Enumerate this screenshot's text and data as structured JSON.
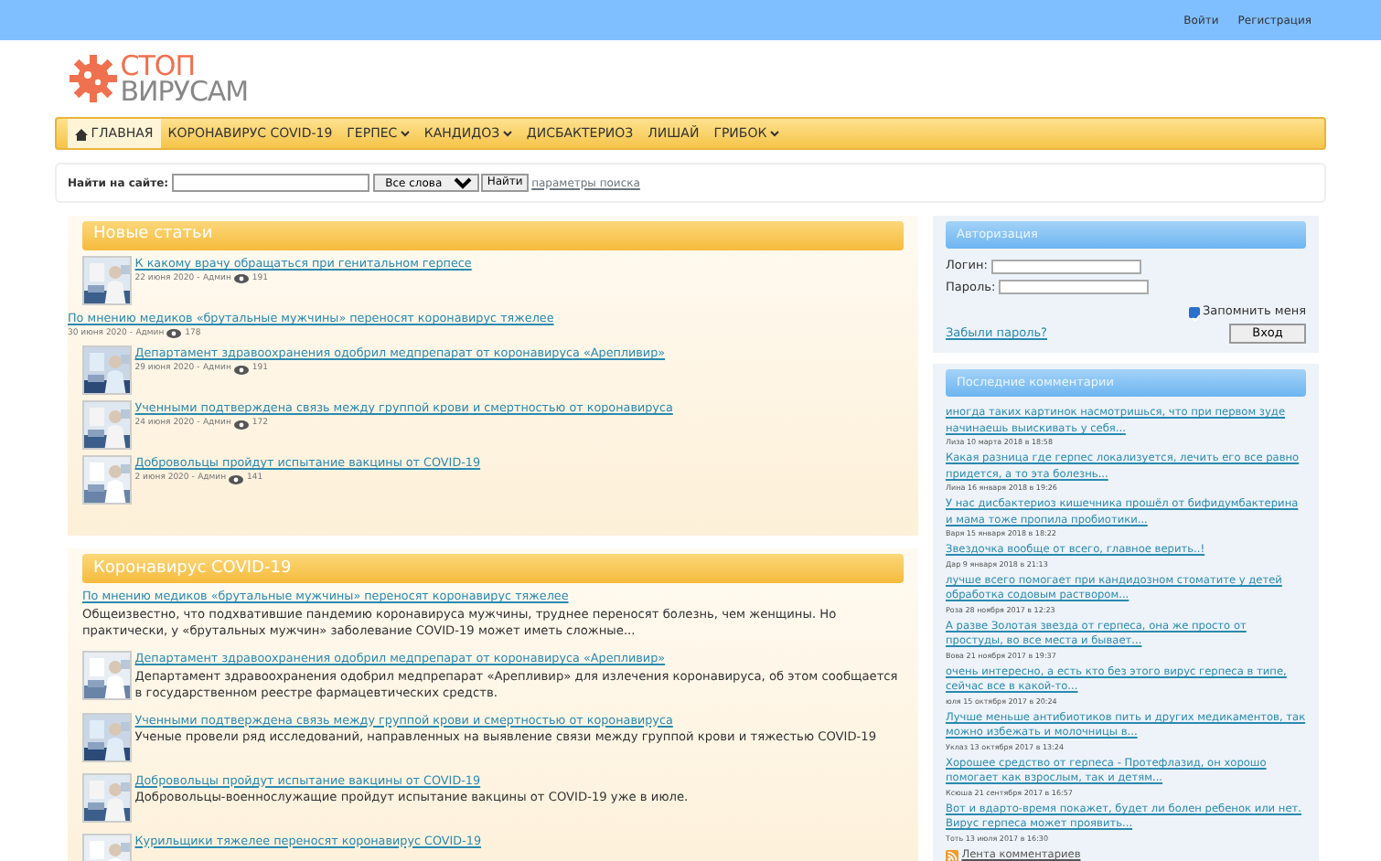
{
  "top_links": [
    "Войти",
    "Регистрация"
  ],
  "logo": {
    "line_1": "СТОП",
    "line_2": "ВИРУСАМ"
  },
  "nav": [
    {
      "label": "ГЛАВНАЯ",
      "selected": true,
      "has_menu": false,
      "home": true
    },
    {
      "label": "КОРОНАВИРУС COVID-19",
      "selected": false,
      "has_menu": false,
      "home": false
    },
    {
      "label": "ГЕРПЕС",
      "selected": false,
      "has_menu": true,
      "home": false
    },
    {
      "label": "КАНДИДОЗ",
      "selected": false,
      "has_menu": true,
      "home": false
    },
    {
      "label": "ДИСБАКТЕРИОЗ",
      "selected": false,
      "has_menu": false,
      "home": false
    },
    {
      "label": "ЛИШАЙ",
      "selected": false,
      "has_menu": false,
      "home": false
    },
    {
      "label": "ГРИБОК",
      "selected": false,
      "has_menu": true,
      "home": false
    }
  ],
  "search": {
    "label": "Найти на сайте:",
    "mode": "Все слова",
    "button": "Найти",
    "options_link": "параметры поиска"
  },
  "new_articles": {
    "title": "Новые статьи",
    "items": [
      {
        "kind": "thumb",
        "title": "К какому врачу обращаться при генитальном герпесе",
        "date": "22 июня 2020 -",
        "author": "Админ",
        "views": "191"
      },
      {
        "kind": "plain",
        "title": "По мнению медиков «брутальные мужчины» переносят коронавирус тяжелее",
        "date": "30 июня 2020 -",
        "author": "Админ",
        "views": "178"
      },
      {
        "kind": "thumb",
        "title": "Департамент здравоохранения одобрил медпрепарат от коронавируса «Арепливир»",
        "date": "29 июня 2020 -",
        "author": "Админ",
        "views": "191"
      },
      {
        "kind": "thumb",
        "title": "Ученными подтверждена связь между группой крови и смертностью от коронавируса",
        "date": "24 июня 2020 -",
        "author": "Админ",
        "views": "172"
      },
      {
        "kind": "thumb",
        "title": "Добровольцы пройдут испытание вакцины от COVID-19",
        "date": "2 июня 2020 -",
        "author": "Админ",
        "views": "141"
      }
    ]
  },
  "covid": {
    "title": "Коронавирус COVID-19",
    "items": [
      {
        "kind": "plain",
        "title": "По мнению медиков «брутальные мужчины» переносят коронавирус тяжелее",
        "text": "Общеизвестно, что подхватившие пандемию коронавируса мужчины, труднее переносят болезнь, чем женщины. Но практически, у «брутальных мужчин» заболевание COVID-19 может иметь сложные..."
      },
      {
        "kind": "thumb",
        "title": "Департамент здравоохранения одобрил медпрепарат от коронавируса «Арепливир»",
        "text": "Департамент здравоохранения одобрил медпрепарат «Арепливир» для излечения коронавируса, об этом сообщается в государственном реестре фармацевтических средств."
      },
      {
        "kind": "thumb",
        "title": "Ученными подтверждена связь между группой крови и смертностью от коронавируса",
        "text": "Ученые провели ряд исследований, направленных на выявление связи между группой крови и тяжестью COVID-19"
      },
      {
        "kind": "thumb",
        "title": "Добровольцы пройдут испытание вакцины от COVID-19",
        "text": "Добровольцы-военнослужащие пройдут испытание  вакцины от COVID-19 уже в июле."
      },
      {
        "kind": "thumb",
        "title": "Курильщики тяжелее переносят коронавирус COVID-19"
      }
    ]
  },
  "login": {
    "title": "Авторизация",
    "login_label": "Логин:",
    "password_label": "Пароль:",
    "remember": "Запомнить меня",
    "remember_checked": true,
    "forgot": "Забыли пароль?",
    "button": "Вход"
  },
  "comments": {
    "title": "Последние комментарии",
    "items": [
      {
        "text": "иногда таких картинок насмотришься, что при первом зуде начинаешь выискивать у себя...",
        "meta": "Лиза 10 марта 2018 в 18:58"
      },
      {
        "text": "Какая разница где герпес локализуется, лечить его все равно придется, а то эта болезнь...",
        "meta": "Лина 16 января 2018 в 19:26"
      },
      {
        "text": "У нас дисбактериоз кишечника прошёл от бифидумбактерина и мама тоже пропила пробиотики...",
        "meta": "Варя 15 января 2018 в 18:22"
      },
      {
        "text": "Звездочка вообще от всего, главное верить..!",
        "meta": "Дар 9 января 2018 в 21:13"
      },
      {
        "text": "лучше всего помогает при кандидозном стоматите у детей обработка содовым раствором...",
        "meta": "Роза 28 ноября 2017 в 12:23"
      },
      {
        "text": "А разве Золотая звезда от герпеса, она же просто от простуды, во все места и бывает...",
        "meta": "Вова 21 ноября 2017 в 19:37"
      },
      {
        "text": "очень интересно, а есть кто без этого вирус герпеса в типе, сейчас все в какой-то...",
        "meta": "юля 15 октября 2017 в 20:24"
      },
      {
        "text": "Лучше меньше антибиотиков пить и других медикаментов, так можно избежать и молочницы в...",
        "meta": "Уклаз 13 октября 2017 в 13:24"
      },
      {
        "text": "Хорошее средство от герпеса - Протефлазид, он хорошо помогает как взрослым, так и детям...",
        "meta": "Ксюша 21 сентября 2017 в 16:57"
      },
      {
        "text": "Вот и вдарто-время покажет, будет ли болен ребенок или нет. Вирус герпеса может проявить...",
        "meta": "Тоть 13 июля 2017 в 16:30"
      }
    ],
    "feed": "Лента комментариев"
  }
}
